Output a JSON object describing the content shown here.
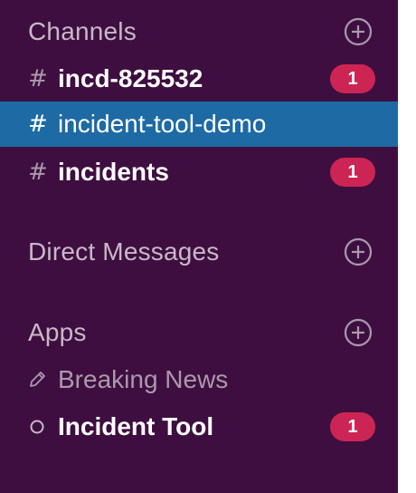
{
  "sections": {
    "channels": {
      "title": "Channels",
      "add_icon": "plus-circle-icon",
      "items": [
        {
          "prefix": "#",
          "label": "incd-825532",
          "unread": true,
          "badge": "1",
          "selected": false
        },
        {
          "prefix": "#",
          "label": "incident-tool-demo",
          "unread": false,
          "badge": null,
          "selected": true
        },
        {
          "prefix": "#",
          "label": "incidents",
          "unread": true,
          "badge": "1",
          "selected": false
        }
      ]
    },
    "direct_messages": {
      "title": "Direct Messages",
      "add_icon": "plus-circle-icon"
    },
    "apps": {
      "title": "Apps",
      "add_icon": "plus-circle-icon",
      "items": [
        {
          "icon": "pencil-icon",
          "label": "Breaking News",
          "unread": false,
          "badge": null
        },
        {
          "icon": "presence-circle-icon",
          "label": "Incident Tool",
          "unread": true,
          "badge": "1"
        }
      ]
    }
  },
  "colors": {
    "sidebar_bg": "#3f0e40",
    "selected_bg": "#1d6aa5",
    "badge_bg": "#cd2553",
    "muted_text": "#a99aab",
    "header_text": "#c7b9c8"
  }
}
